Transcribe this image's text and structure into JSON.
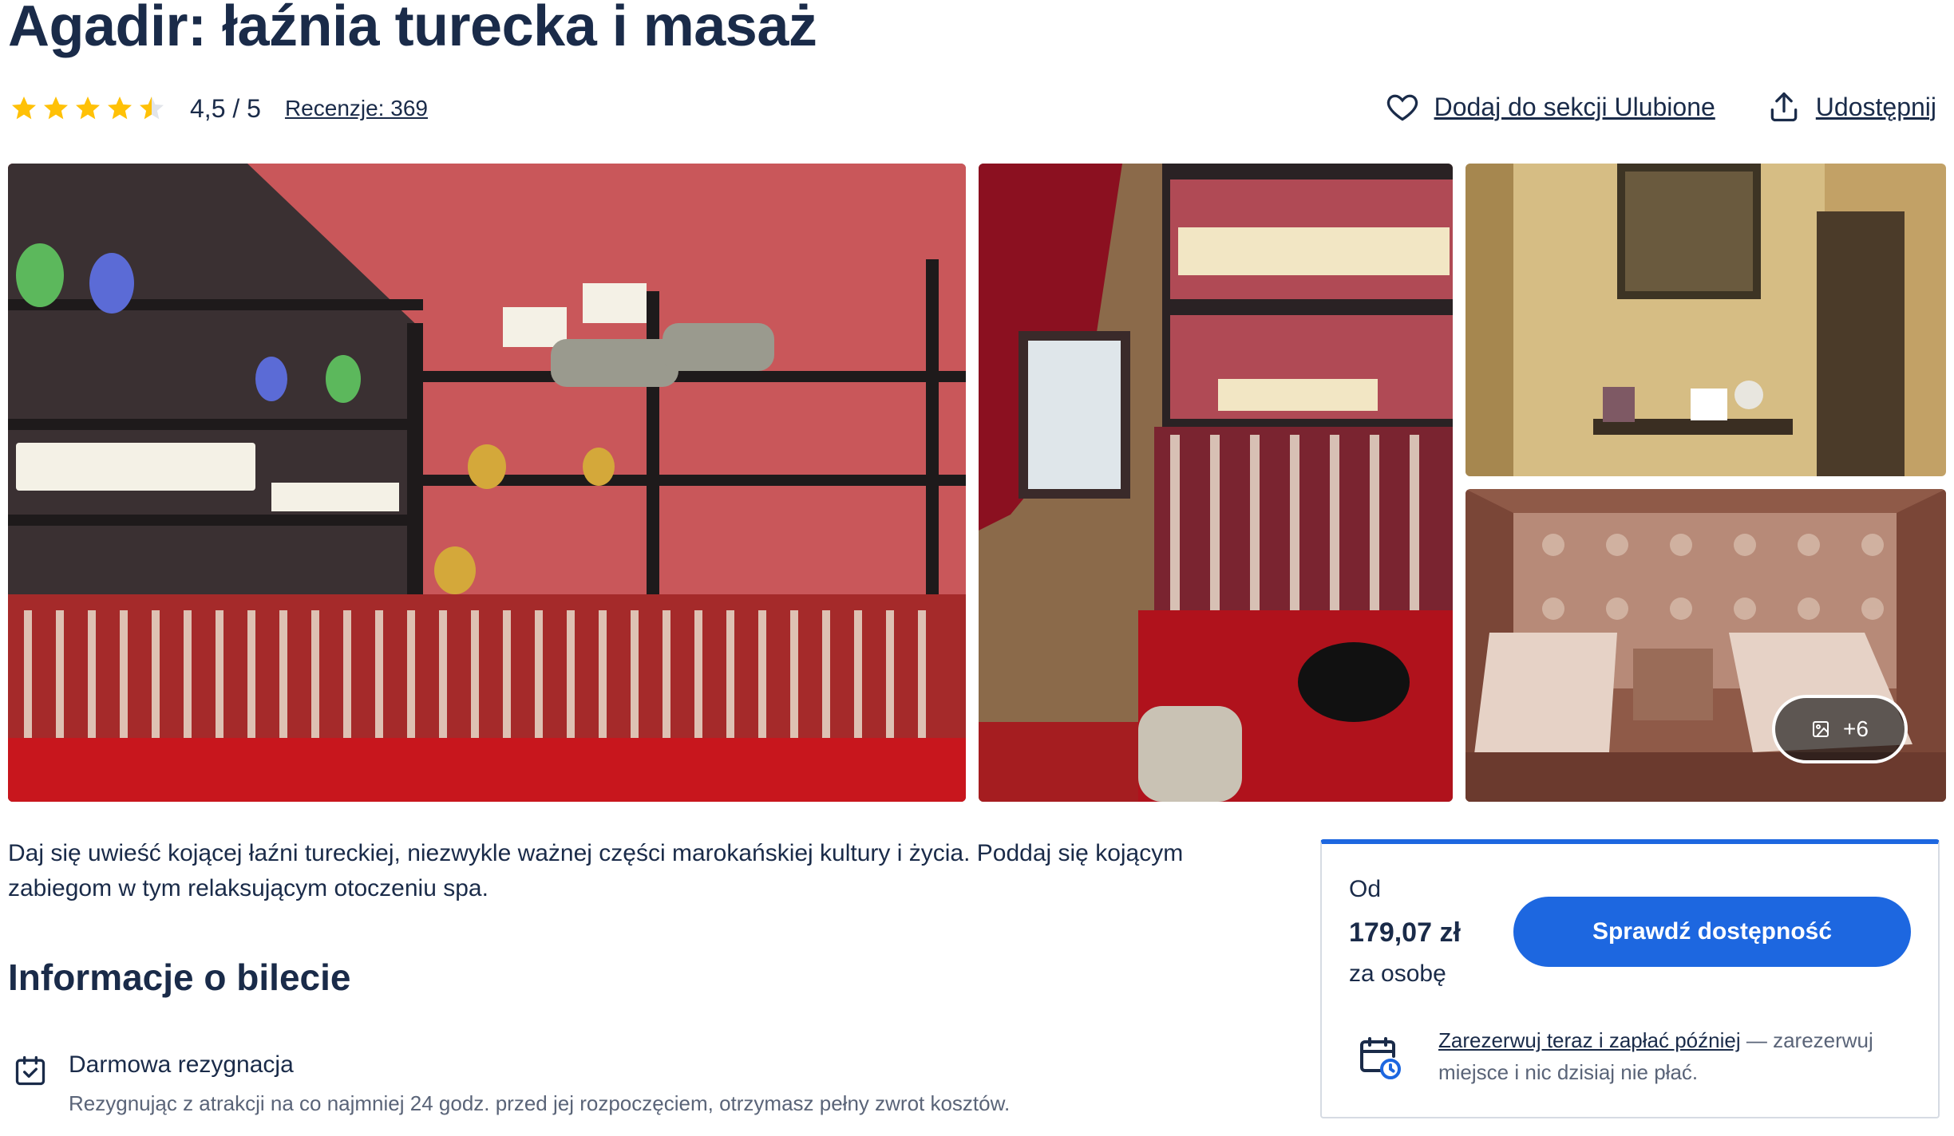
{
  "header": {
    "title": "Agadir: łaźnia turecka i masaż",
    "rating_value": "4,5 / 5",
    "stars": 4.5,
    "reviews_link": "Recenzje: 369",
    "wishlist_label": "Dodaj do sekcji Ulubione",
    "share_label": "Udostępnij"
  },
  "gallery": {
    "more_badge": "+6",
    "icons": [
      "image-icon"
    ]
  },
  "description": "Daj się uwieść kojącej łaźni tureckiej, niezwykle ważnej części marokańskiej kultury i życia. Poddaj się kojącym zabiegom w tym relaksującym otoczeniu spa.",
  "ticket_info": {
    "title": "Informacje o bilecie",
    "items": [
      {
        "title": "Darmowa rezygnacja",
        "description": "Rezygnując z atrakcji na co najmniej 24 godz. przed jej rozpoczęciem, otrzymasz pełny zwrot kosztów."
      }
    ]
  },
  "booking": {
    "from_label": "Od",
    "price": "179,07 zł",
    "per_person": "za osobę",
    "check_button": "Sprawdź dostępność",
    "reserve_link": "Zarezerwuj teraz i zapłać później",
    "reserve_text": " — zarezerwuj miejsce i nic dzisiaj nie płać."
  },
  "colors": {
    "primary": "#1d67e0",
    "text": "#1a2b49",
    "muted": "#5a6478",
    "star": "#ffc107",
    "border": "#d6dbe3"
  }
}
